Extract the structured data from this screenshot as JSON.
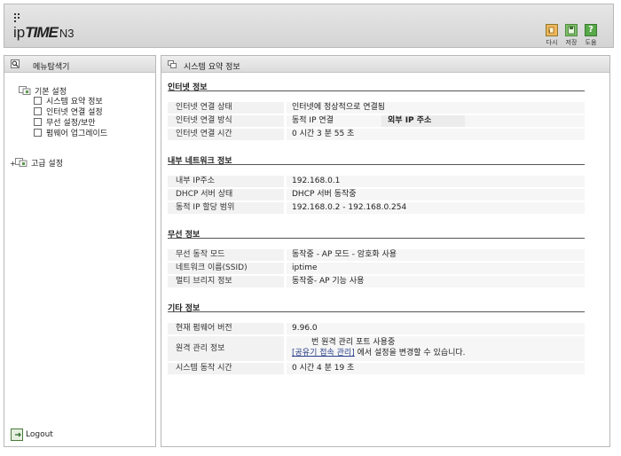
{
  "header": {
    "logo": {
      "ip": "ip",
      "time": "TIME",
      "model": "N3"
    },
    "buttons": [
      {
        "label": "다시",
        "icon": "reload-icon"
      },
      {
        "label": "저장",
        "icon": "save-icon"
      },
      {
        "label": "도움",
        "icon": "help-icon",
        "glyph": "?"
      }
    ]
  },
  "sidebar": {
    "title": "메뉴탐색기",
    "basic_group": "기본 설정",
    "items": [
      {
        "label": "시스템 요약 정보",
        "icon": "chart-icon"
      },
      {
        "label": "인터넷 연결 설정",
        "icon": "network-icon"
      },
      {
        "label": "무선 설정/보안",
        "icon": "wireless-icon"
      },
      {
        "label": "펌웨어 업그레이드",
        "icon": "upgrade-icon"
      }
    ],
    "advanced_group": "고급 설정",
    "logout": "Logout"
  },
  "main": {
    "title": "시스템 요약 정보",
    "internet": {
      "title": "인터넷 정보",
      "rows": [
        {
          "label": "인터넷 연결 상태",
          "value": "인터넷에 정상적으로 연결됨"
        },
        {
          "label": "인터넷 연결 방식",
          "value": "동적 IP 연결",
          "extra": "외부 IP 주소"
        },
        {
          "label": "인터넷 연결 시간",
          "value": "0 시간 3 분 55 초"
        }
      ]
    },
    "lan": {
      "title": "내부 네트워크 정보",
      "rows": [
        {
          "label": "내부 IP주소",
          "value": "192.168.0.1"
        },
        {
          "label": "DHCP 서버 상태",
          "value": "DHCP 서버 동작중"
        },
        {
          "label": "동적 IP 할당 범위",
          "value": "192.168.0.2 - 192.168.0.254"
        }
      ]
    },
    "wireless": {
      "title": "무선 정보",
      "rows": [
        {
          "label": "무선 동작 모드",
          "value": "동작중 - AP 모드 - 암호화 사용"
        },
        {
          "label": "네트워크 이름(SSID)",
          "value": "iptime"
        },
        {
          "label": "멀티 브리지 정보",
          "value": "동작중- AP 기능 사용"
        }
      ]
    },
    "other": {
      "title": "기타 정보",
      "firmware_label": "현재 펌웨어 버전",
      "firmware_value": "9.96.0",
      "remote_label": "원격 관리 정보",
      "remote_line1": "번 원격 관리 포트 사용중",
      "remote_link": "[공유기 접속 관리]",
      "remote_line2": "에서 설정을 변경할 수 있습니다.",
      "uptime_label": "시스템 동작 시간",
      "uptime_value": "0 시간 4 분 19 초"
    }
  }
}
